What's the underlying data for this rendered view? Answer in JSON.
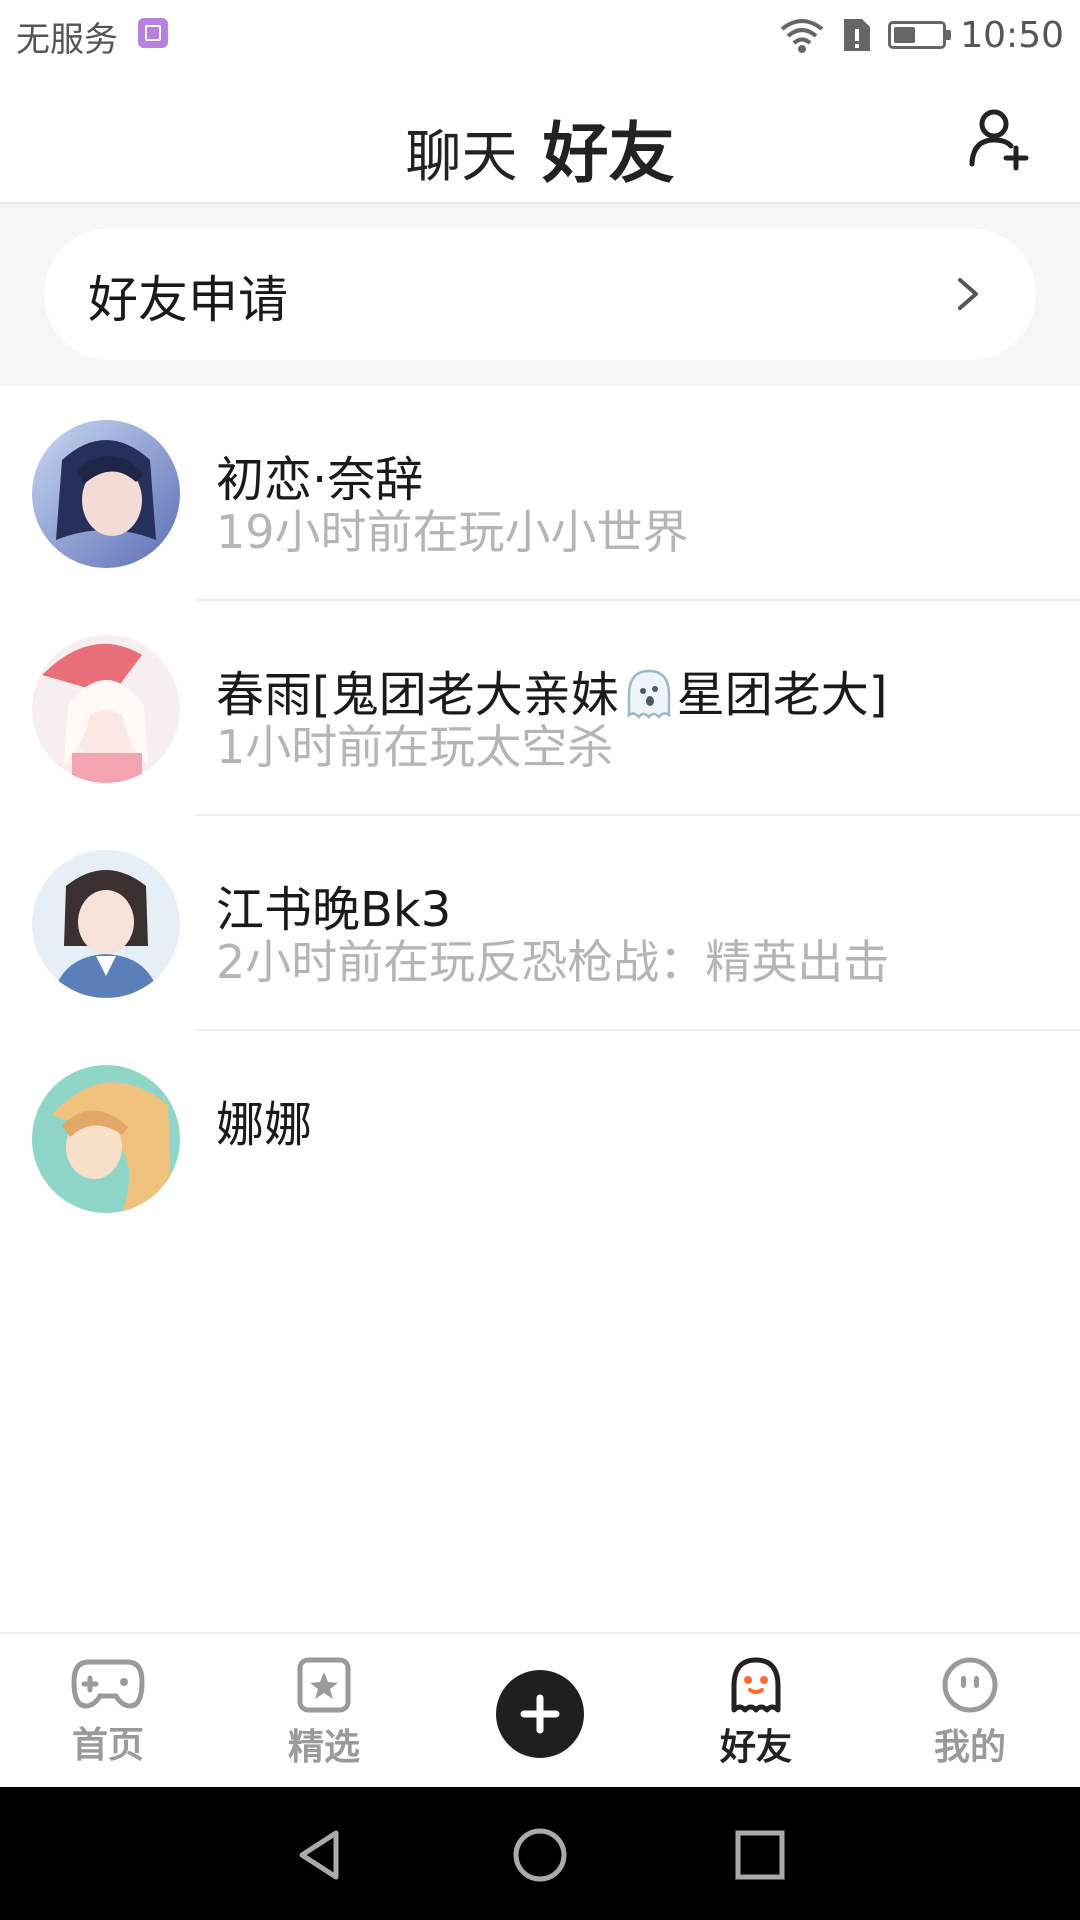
{
  "status_bar": {
    "carrier": "无服务",
    "time": "10:50",
    "battery_level": 0.45
  },
  "header": {
    "tab_chat": "聊天",
    "tab_friends": "好友",
    "add_friend_icon": "person-add-icon"
  },
  "friend_request": {
    "label": "好友申请"
  },
  "friends": [
    {
      "name": "初恋·奈辞",
      "status": "19小时前在玩小小世界",
      "avatar_color": "#6b7fc0"
    },
    {
      "name_before_emoji": "春雨[鬼团老大亲妹",
      "name_after_emoji": "星团老大]",
      "status": "1小时前在玩太空杀",
      "avatar_color": "#f1c9cc"
    },
    {
      "name": "江书晚Bk3",
      "status": "2小时前在玩反恐枪战：精英出击",
      "avatar_color": "#8aa3c8"
    },
    {
      "name": "娜娜",
      "status": "",
      "avatar_color": "#e8b07a"
    }
  ],
  "bottom_nav": {
    "home": "首页",
    "featured": "精选",
    "friends": "好友",
    "mine": "我的"
  },
  "colors": {
    "accent": "#ff5a1f",
    "status_text": "#b5b5b5"
  }
}
